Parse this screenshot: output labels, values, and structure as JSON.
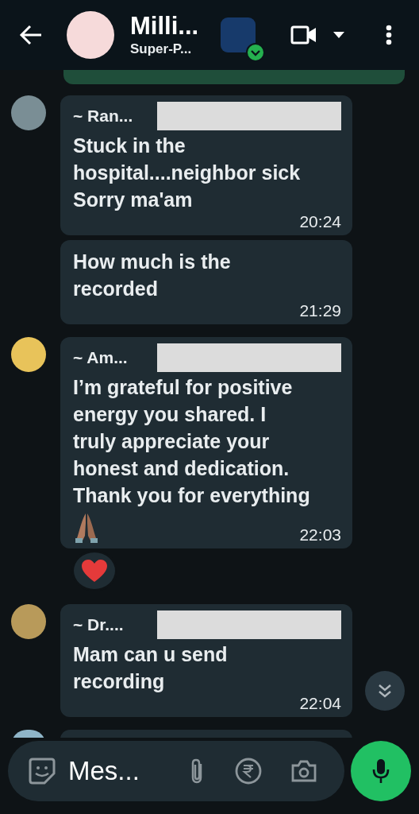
{
  "header": {
    "title": "Milli...",
    "subtitle": "Super-P...",
    "community_verified": true
  },
  "messages": [
    {
      "kind": "first",
      "sender": "~ Ran...",
      "text": "Stuck in the\nhospital....neighbor sick\nSorry ma'am",
      "time": "20:24"
    },
    {
      "kind": "continued",
      "text": "How much is the\nrecorded",
      "time": "21:29"
    },
    {
      "kind": "first",
      "sender": "~ Am...",
      "text": "I’m grateful for positive\nenergy you shared. I\ntruly appreciate your\nhonest and dedication.\nThank you for everything",
      "praying_hands": true,
      "time": "22:03",
      "heart_reaction": true
    },
    {
      "kind": "first",
      "sender": "~ Dr....",
      "text": "Mam can u send\nrecording",
      "time": "22:04"
    }
  ],
  "composer": {
    "placeholder": "Mes..."
  }
}
